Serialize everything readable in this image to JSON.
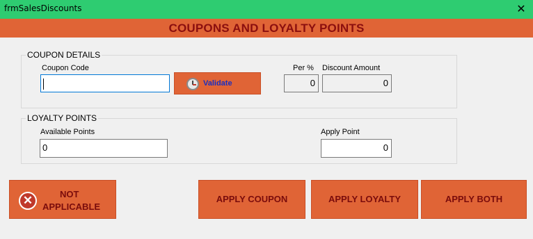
{
  "window": {
    "title": "frmSalesDiscounts",
    "close_glyph": "✕"
  },
  "header": {
    "title": "COUPONS AND LOYALTY POINTS"
  },
  "coupon": {
    "group_title": "COUPON DETAILS",
    "code_label": "Coupon Code",
    "code_value": "",
    "validate_label": "Validate",
    "per_label": "Per %",
    "per_value": "0",
    "discount_label": "Discount Amount",
    "discount_value": "0"
  },
  "loyalty": {
    "group_title": "LOYALTY POINTS",
    "available_label": "Available Points",
    "available_value": "0",
    "apply_label": "Apply Point",
    "apply_value": "0"
  },
  "actions": {
    "not_applicable_line1": "NOT",
    "not_applicable_line2": "APPLICABLE",
    "apply_coupon": "APPLY COUPON",
    "apply_loyalty": "APPLY LOYALTY",
    "apply_both": "APPLY BOTH"
  },
  "icons": {
    "validate": "clock-icon",
    "not_applicable": "x-circle-icon"
  },
  "colors": {
    "titlebar": "#2ecc71",
    "accent": "#e06436",
    "header_text": "#8b0f0f"
  }
}
